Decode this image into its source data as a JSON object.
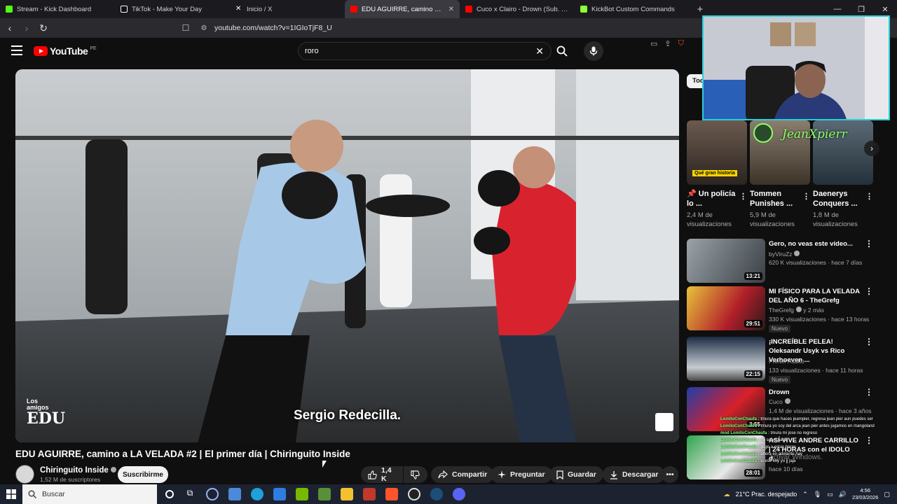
{
  "browser": {
    "tabs": [
      {
        "label": "Stream - Kick Dashboard",
        "color": "#53fc18"
      },
      {
        "label": "TikTok - Make Your Day",
        "color": "#ffffff"
      },
      {
        "label": "Inicio / X",
        "color": "#ffffff"
      },
      {
        "label": "EDU AGUIRRE, camino a LA VELADA",
        "color": "#ff0000"
      },
      {
        "label": "Cuco x Clairo - Drown (Sub. Español)",
        "color": "#ff0000"
      },
      {
        "label": "KickBot Custom Commands",
        "color": "#8cff3a"
      }
    ],
    "new_tab": "+",
    "url": "youtube.com/watch?v=1IGIoTjF8_U"
  },
  "youtube": {
    "logo_text": "YouTube",
    "country": "PE",
    "search_value": "roro"
  },
  "video": {
    "subtitle": "Sergio Redecilla.",
    "watermark": {
      "line1": "Los",
      "line2": "amigos",
      "line3": "EDU"
    },
    "title": "EDU AGUIRRE, camino a LA VELADA #2 | El primer día | Chiringuito Inside",
    "channel": "Chiringuito Inside",
    "subscribers": "1,52 M de suscriptores",
    "subscribe_label": "Suscribirme",
    "likes": "1,4 K",
    "share_label": "Compartir",
    "ask_label": "Preguntar",
    "save_label": "Guardar",
    "download_label": "Descargar"
  },
  "sidebar": {
    "chip": "Tod",
    "shorts": [
      {
        "title": "Un policía lo ...",
        "views": "2,4 M de visualizaciones",
        "badge": "Qué gran historia"
      },
      {
        "title": "Tommen Punishes ...",
        "views": "5,9 M de visualizaciones"
      },
      {
        "title": "Daenerys Conquers ...",
        "views": "1,8 M de visualizaciones"
      }
    ],
    "recs": [
      {
        "title": "Gero, no veas este vídeo...",
        "channel": "byViruZz",
        "meta": "620 K visualizaciones · hace 7 días",
        "duration": "13:21",
        "nuevo": ""
      },
      {
        "title": "MI FÍSICO PARA LA VELADA DEL AÑO 6 - TheGrefg",
        "channel": "TheGrefg",
        "channel_extra": "y 2 más",
        "meta": "330 K visualizaciones · hace 13 horas",
        "duration": "29:51",
        "nuevo": "Nuevo"
      },
      {
        "title": "¡INCREÍBLE PELEA! Oleksandr Usyk vs Rico Verhoeven ...",
        "channel": "Primer Asalto",
        "meta": "133 visualizaciones · hace 11 horas",
        "duration": "22:15",
        "nuevo": "Nuevo"
      },
      {
        "title": "Drown",
        "channel": "Cuco",
        "meta": "1,4 M de visualizaciones · hace 3 años",
        "duration": "3:55",
        "nuevo": ""
      },
      {
        "title": "ASÍ VIVE ANDRE CARRILLO | 24 HORAS con el IDOLO d...",
        "channel": "",
        "meta": "hace 10 días",
        "duration": "28:01",
        "nuevo": ""
      }
    ]
  },
  "overlay": {
    "cam_name": "JeanXpierr",
    "chat": [
      {
        "who": "LomitoConChaufa :",
        "msg": "tmura que haces jeampier, regresa jean pier aun puedes ser"
      },
      {
        "who": "LomitoConChaufa :",
        "msg": "tmura yo soy del arca jean pier antes jugamos en mangoland"
      },
      {
        "who": "mod LomitoConChaufa :",
        "msg": "tmura mi jose no regreso"
      },
      {
        "who": "LomitoConChaufa :",
        "msg": "no se ve nada"
      },
      {
        "who": "LomitoConChaufa :",
        "msg": "llego a estas horas"
      },
      {
        "who": "LomitoConChaufa :",
        "msg": "ahora en adelante hay"
      },
      {
        "who": "LomitoConChaufa :",
        "msg": "si ese soy yo jj jaja"
      }
    ],
    "activate_windows": "activar Windows."
  },
  "taskbar": {
    "search_placeholder": "Buscar",
    "weather": "21°C  Prac. despejado",
    "time": "4:56",
    "date": "23/03/2026"
  }
}
